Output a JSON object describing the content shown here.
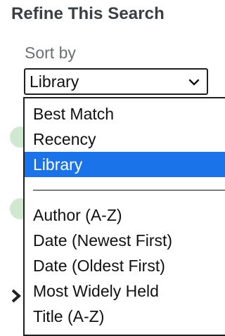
{
  "panel": {
    "title": "Refine This Search"
  },
  "sort": {
    "label": "Sort by",
    "selected_value": "Library",
    "options": [
      {
        "label": "Best Match",
        "selected": false
      },
      {
        "label": "Recency",
        "selected": false
      },
      {
        "label": "Library",
        "selected": true
      },
      {
        "label": "Author (A-Z)",
        "selected": false
      },
      {
        "label": "Date (Newest First)",
        "selected": false
      },
      {
        "label": "Date (Oldest First)",
        "selected": false
      },
      {
        "label": "Most Widely Held",
        "selected": false
      },
      {
        "label": "Title (A-Z)",
        "selected": false
      }
    ]
  },
  "colors": {
    "title_text": "#3a3f44",
    "selected_option_bg": "#1a73e8",
    "selected_option_text": "#ffffff",
    "partial_circle": "#cfe8cf"
  },
  "icons": {
    "select_chevron": "chevron-down-icon",
    "background_arrow": "chevron-right-icon"
  }
}
